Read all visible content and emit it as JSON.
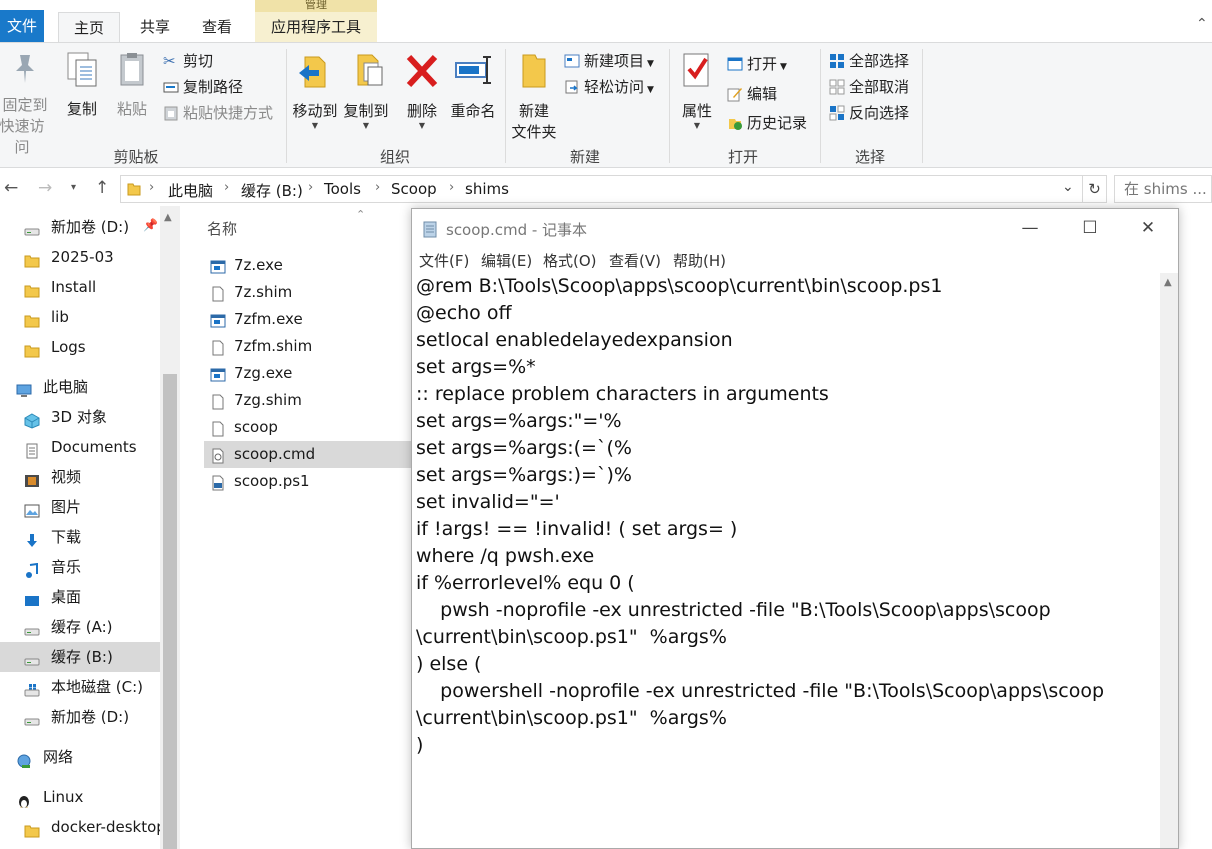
{
  "ribbon_tabs": {
    "file": "文件",
    "home": "主页",
    "share": "共享",
    "view": "查看",
    "app_tools": "应用程序工具",
    "app_tools_context": "管理"
  },
  "ribbon": {
    "clipboard": {
      "label": "剪贴板",
      "pin_line1": "固定到",
      "pin_line2": "快速访问",
      "copy": "复制",
      "paste": "粘贴",
      "cut": "剪切",
      "copy_path": "复制路径",
      "paste_shortcut": "粘贴快捷方式"
    },
    "organize": {
      "label": "组织",
      "move_to": "移动到",
      "copy_to": "复制到",
      "delete": "删除",
      "rename": "重命名"
    },
    "new": {
      "label": "新建",
      "new_folder_line1": "新建",
      "new_folder_line2": "文件夹",
      "new_item": "新建项目",
      "easy_access": "轻松访问"
    },
    "open": {
      "label": "打开",
      "properties": "属性",
      "open": "打开",
      "edit": "编辑",
      "history": "历史记录"
    },
    "select": {
      "label": "选择",
      "select_all": "全部选择",
      "select_none": "全部取消",
      "invert": "反向选择"
    }
  },
  "address": {
    "crumbs": [
      "此电脑",
      "缓存 (B:)",
      "Tools",
      "Scoop",
      "shims"
    ],
    "search_placeholder": "在 shims ..."
  },
  "nav": {
    "items": [
      {
        "label": "新加卷 (D:)",
        "icon": "drive-icon"
      },
      {
        "label": "2025-03",
        "icon": "folder-icon"
      },
      {
        "label": "Install",
        "icon": "folder-icon"
      },
      {
        "label": "lib",
        "icon": "folder-icon"
      },
      {
        "label": "Logs",
        "icon": "folder-icon"
      },
      {
        "label": "此电脑",
        "icon": "computer-icon"
      },
      {
        "label": "3D 对象",
        "icon": "cube-icon"
      },
      {
        "label": "Documents",
        "icon": "document-icon"
      },
      {
        "label": "视频",
        "icon": "video-icon"
      },
      {
        "label": "图片",
        "icon": "picture-icon"
      },
      {
        "label": "下载",
        "icon": "download-icon"
      },
      {
        "label": "音乐",
        "icon": "music-icon"
      },
      {
        "label": "桌面",
        "icon": "desktop-icon"
      },
      {
        "label": "缓存 (A:)",
        "icon": "drive-icon"
      },
      {
        "label": "缓存 (B:)",
        "icon": "drive-icon"
      },
      {
        "label": "本地磁盘 (C:)",
        "icon": "windows-drive-icon"
      },
      {
        "label": "新加卷 (D:)",
        "icon": "drive-icon"
      },
      {
        "label": "网络",
        "icon": "network-icon"
      },
      {
        "label": "Linux",
        "icon": "linux-icon"
      },
      {
        "label": "docker-desktop",
        "icon": "folder-icon"
      }
    ]
  },
  "filelist": {
    "column_name": "名称",
    "files": [
      {
        "name": "7z.exe",
        "icon": "exe-icon"
      },
      {
        "name": "7z.shim",
        "icon": "file-icon"
      },
      {
        "name": "7zfm.exe",
        "icon": "exe-icon"
      },
      {
        "name": "7zfm.shim",
        "icon": "file-icon"
      },
      {
        "name": "7zg.exe",
        "icon": "exe-icon"
      },
      {
        "name": "7zg.shim",
        "icon": "file-icon"
      },
      {
        "name": "scoop",
        "icon": "file-icon"
      },
      {
        "name": "scoop.cmd",
        "icon": "cmd-icon"
      },
      {
        "name": "scoop.ps1",
        "icon": "ps1-icon"
      }
    ]
  },
  "notepad": {
    "title": "scoop.cmd - 记事本",
    "menu": [
      "文件(F)",
      "编辑(E)",
      "格式(O)",
      "查看(V)",
      "帮助(H)"
    ],
    "lines": [
      "@rem B:\\Tools\\Scoop\\apps\\scoop\\current\\bin\\scoop.ps1",
      "@echo off",
      "setlocal enabledelayedexpansion",
      "set args=%*",
      ":: replace problem characters in arguments",
      "set args=%args:\"='%",
      "set args=%args:(=`(%",
      "set args=%args:)=`)%",
      "set invalid=\"='",
      "if !args! == !invalid! ( set args= )",
      "where /q pwsh.exe",
      "if %errorlevel% equ 0 (",
      "    pwsh -noprofile -ex unrestricted -file \"B:\\Tools\\Scoop\\apps\\scoop",
      "\\current\\bin\\scoop.ps1\"  %args%",
      ") else (",
      "    powershell -noprofile -ex unrestricted -file \"B:\\Tools\\Scoop\\apps\\scoop",
      "\\current\\bin\\scoop.ps1\"  %args%",
      ")"
    ]
  },
  "colors": {
    "accent": "#1979ca",
    "selection": "#d9d9d9",
    "ribbon_bg": "#f5f6f7"
  }
}
